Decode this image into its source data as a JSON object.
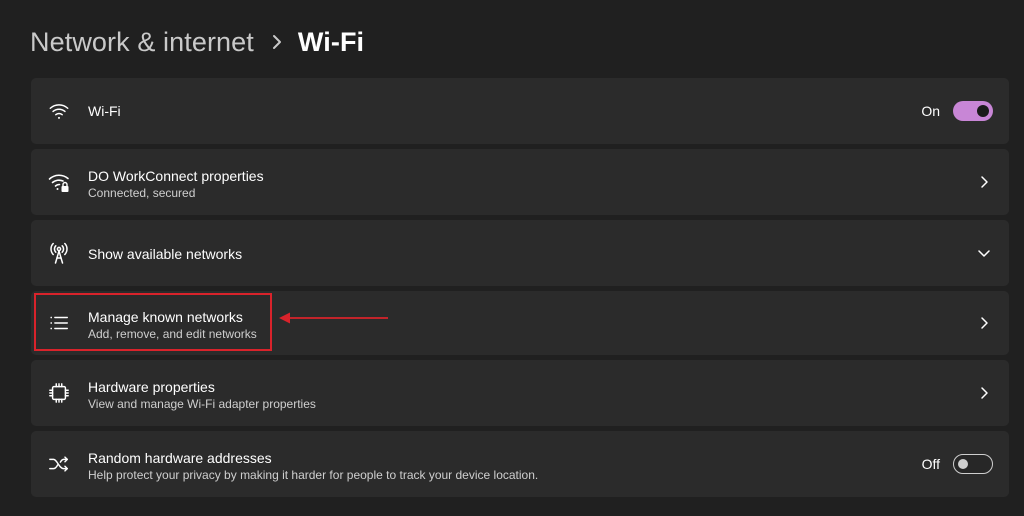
{
  "breadcrumb": {
    "parent": "Network & internet",
    "separator_icon": "chevron-right-icon",
    "current": "Wi-Fi"
  },
  "rows": [
    {
      "id": "wifi",
      "icon": "wifi-icon",
      "title": "Wi-Fi",
      "toggle_state": "On",
      "toggle_on": true
    },
    {
      "id": "properties",
      "icon": "wifi-lock-icon",
      "title": "DO WorkConnect properties",
      "subtitle": "Connected, secured",
      "action": "chevron-right-icon"
    },
    {
      "id": "available",
      "icon": "antenna-icon",
      "title": "Show available networks",
      "action": "chevron-down-icon"
    },
    {
      "id": "manage",
      "icon": "list-icon",
      "title": "Manage known networks",
      "subtitle": "Add, remove, and edit networks",
      "action": "chevron-right-icon"
    },
    {
      "id": "hardware",
      "icon": "chip-icon",
      "title": "Hardware properties",
      "subtitle": "View and manage Wi-Fi adapter properties",
      "action": "chevron-right-icon"
    },
    {
      "id": "random",
      "icon": "shuffle-icon",
      "title": "Random hardware addresses",
      "subtitle": "Help protect your privacy by making it harder for people to track your device location.",
      "toggle_state": "Off",
      "toggle_on": false
    }
  ],
  "annotation": {
    "color": "#d9232b",
    "target": "Manage known networks"
  },
  "colors": {
    "background": "#202020",
    "card": "#2b2b2b",
    "accent": "#c886d6"
  }
}
